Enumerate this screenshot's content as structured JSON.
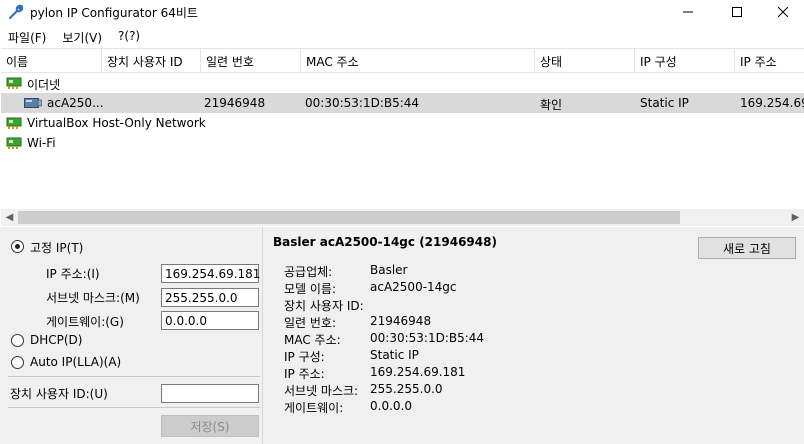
{
  "window": {
    "title": "pylon IP Configurator 64비트"
  },
  "menu": [
    "파일(F)",
    "보기(V)",
    "?(?)"
  ],
  "list": {
    "columns": [
      "이름",
      "장치 사용자 ID",
      "일련 번호",
      "MAC 주소",
      "상태",
      "IP 구성",
      "IP 주소"
    ],
    "rows": [
      {
        "type": "adapter",
        "name": "이더넷"
      },
      {
        "type": "camera",
        "name": "acA250...",
        "user_id": "",
        "serial": "21946948",
        "mac": "00:30:53:1D:B5:44",
        "status": "확인",
        "ip_config": "Static IP",
        "ip": "169.254.69."
      },
      {
        "type": "adapter",
        "name": "VirtualBox Host-Only Network"
      },
      {
        "type": "adapter",
        "name": "Wi-Fi"
      }
    ]
  },
  "form": {
    "static_ip_label": "고정 IP(T)",
    "ip_label": "IP 주소:(I)",
    "ip_value": "169.254.69.181",
    "subnet_label": "서브넷 마스크:(M)",
    "subnet_value": "255.255.0.0",
    "gateway_label": "게이트웨이:(G)",
    "gateway_value": "0.0.0.0",
    "dhcp_label": "DHCP(D)",
    "autoip_label": "Auto IP(LLA)(A)",
    "user_id_label": "장치 사용자 ID:(U)",
    "user_id_value": "",
    "save_label": "저장(S)",
    "selected_mode": "static"
  },
  "details": {
    "title": "Basler acA2500-14gc (21946948)",
    "refresh_label": "새로 고침",
    "fields": [
      {
        "key": "공급업체:",
        "value": "Basler"
      },
      {
        "key": "모델 이름:",
        "value": "acA2500-14gc"
      },
      {
        "key": "장치 사용자 ID:",
        "value": ""
      },
      {
        "key": "일련 번호:",
        "value": "21946948"
      },
      {
        "key": "MAC 주소:",
        "value": "00:30:53:1D:B5:44"
      },
      {
        "key": "IP 구성:",
        "value": "Static IP"
      },
      {
        "key": "IP 주소:",
        "value": "169.254.69.181"
      },
      {
        "key": "서브넷 마스크:",
        "value": "255.255.0.0"
      },
      {
        "key": "게이트웨이:",
        "value": "0.0.0.0"
      }
    ]
  },
  "colors": {
    "selection": "#d9d9d9",
    "pane": "#f0f0f0",
    "nic_green": "#2e9b2e"
  },
  "icons": {
    "app": "wrench-icon",
    "adapter": "network-card-icon",
    "camera": "camera-icon"
  }
}
